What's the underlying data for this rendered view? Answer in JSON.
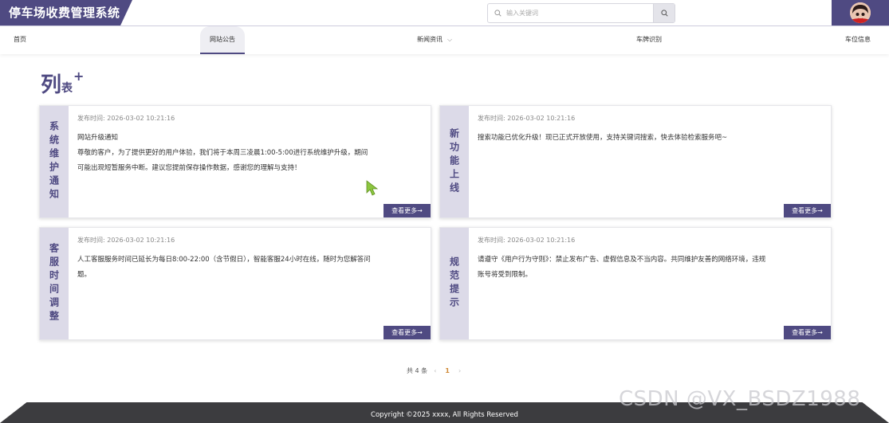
{
  "app": {
    "title": "停车场收费管理系统"
  },
  "search": {
    "placeholder": "输入关键词"
  },
  "nav": {
    "home": "首页",
    "announcements": "网站公告",
    "news": "新闻资讯",
    "plate": "车牌识别",
    "spaces": "车位信息"
  },
  "page": {
    "title_big": "列",
    "title_small": "表",
    "title_plus": "+"
  },
  "cards": [
    {
      "side": "系统维护通知",
      "time": "发布时间: 2026-03-02 10:21:16",
      "lines": [
        "网站升级通知",
        "尊敬的客户，为了提供更好的用户体验，我们将于本周三凌晨1:00-5:00进行系统维护升级，期间",
        "可能出现短暂服务中断。建议您提前保存操作数据，感谢您的理解与支持！"
      ],
      "more": "查看更多→"
    },
    {
      "side": "新功能上线",
      "time": "发布时间: 2026-03-02 10:21:16",
      "lines": [
        "搜索功能已优化升级！现已正式开放使用，支持关键词搜索，快去体验检索服务吧~"
      ],
      "more": "查看更多→"
    },
    {
      "side": "客服时间调整",
      "time": "发布时间: 2026-03-02 10:21:16",
      "lines": [
        "人工客服服务时间已延长为每日8:00-22:00（含节假日），智能客服24小时在线，随时为您解答问",
        "题。"
      ],
      "more": "查看更多→"
    },
    {
      "side": "规范提示",
      "time": "发布时间: 2026-03-02 10:21:16",
      "lines": [
        "请遵守《用户行为守则》：禁止发布广告、虚假信息及不当内容。共同维护友善的网络环境，违规",
        "账号将受到限制。"
      ],
      "more": "查看更多→"
    }
  ],
  "pagination": {
    "total": "共 4 条",
    "prev": "‹",
    "current": "1",
    "next": "›"
  },
  "footer": {
    "copyright": "Copyright ©2025 xxxx, All Rights Reserved"
  },
  "watermark": "CSDN @VX_BSDZ1988",
  "colors": {
    "primary": "#4f4a82",
    "side": "#dcdae8",
    "accent": "#d08a37",
    "footer": "#3c3c3f"
  }
}
